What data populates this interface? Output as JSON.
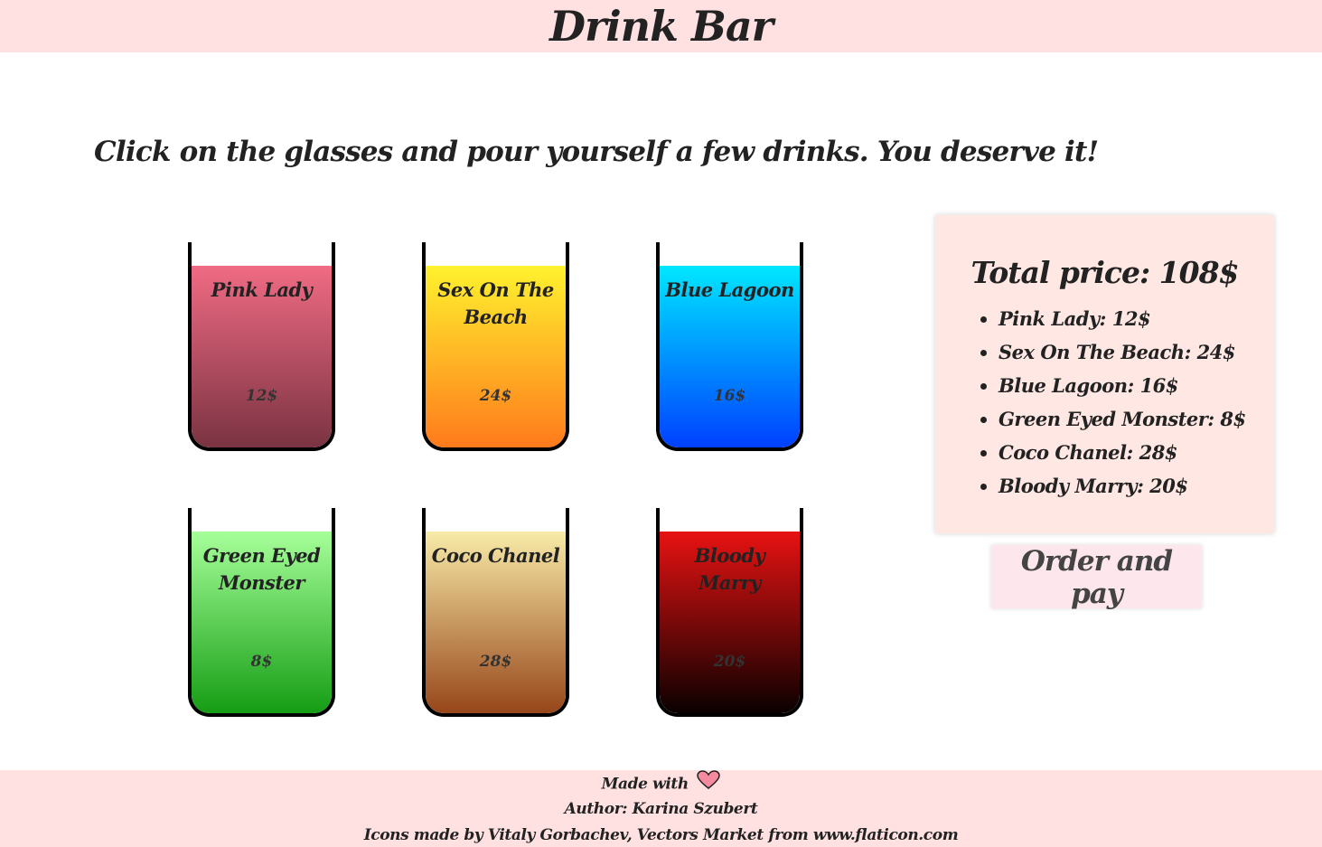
{
  "header": {
    "title": "Drink Bar"
  },
  "intro": {
    "text": "Click on the glasses and pour yourself a few drinks. You deserve it!"
  },
  "drinks": [
    {
      "name": "Pink Lady",
      "price": "12$",
      "color_top": "#f06b84",
      "color_bottom": "#7a3342"
    },
    {
      "name": "Sex On The Beach",
      "price": "24$",
      "color_top": "#fff22e",
      "color_bottom": "#ff7a1c"
    },
    {
      "name": "Blue Lagoon",
      "price": "16$",
      "color_top": "#00e7ff",
      "color_bottom": "#0040ff"
    },
    {
      "name": "Green Eyed Monster",
      "price": "8$",
      "color_top": "#a6ff99",
      "color_bottom": "#159d14"
    },
    {
      "name": "Coco Chanel",
      "price": "28$",
      "color_top": "#f8eba8",
      "color_bottom": "#97461a"
    },
    {
      "name": "Bloody Marry",
      "price": "20$",
      "color_top": "#e81212",
      "color_bottom": "#0a0000"
    }
  ],
  "summary": {
    "total": "Total price: 108$",
    "items": [
      "Pink Lady: 12$",
      "Sex On The Beach: 24$",
      "Blue Lagoon: 16$",
      "Green Eyed Monster: 8$",
      "Coco Chanel: 28$",
      "Bloody Marry: 20$"
    ]
  },
  "order_button": {
    "label": "Order and pay"
  },
  "footer": {
    "made_with": "Made with",
    "heart_icon": "heart-icon",
    "author": "Author: Karina Szubert",
    "credits": "Icons made by Vitaly Gorbachev, Vectors Market from www.flaticon.com"
  },
  "colors": {
    "header_bg": "#ffe1e2",
    "summary_bg": "#ffe8e4",
    "button_bg": "#fde6ec",
    "heart": "#f48a9e"
  }
}
